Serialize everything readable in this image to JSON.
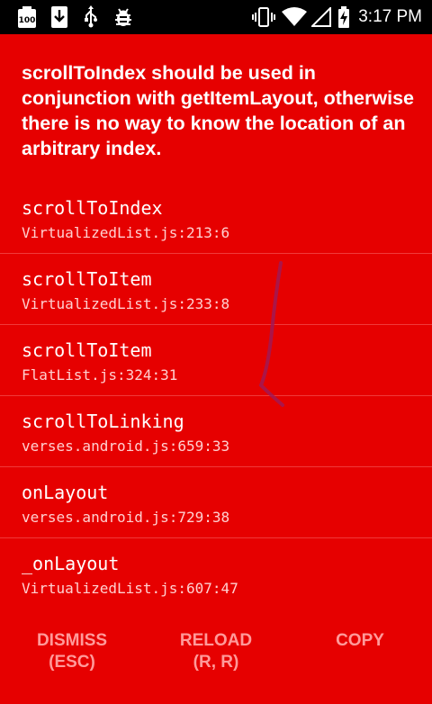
{
  "status_bar": {
    "time": "3:17 PM",
    "left_icons": [
      "battery-100-icon",
      "download-icon",
      "usb-icon",
      "bug-icon"
    ],
    "right_icons": [
      "vibrate-icon",
      "wifi-icon",
      "signal-icon",
      "battery-charging-icon"
    ]
  },
  "error": {
    "message": "scrollToIndex should be used in conjunction with getItemLayout, otherwise there is no way to know the location of an arbitrary index."
  },
  "stack": [
    {
      "method": "scrollToIndex",
      "location": "VirtualizedList.js:213:6"
    },
    {
      "method": "scrollToItem",
      "location": "VirtualizedList.js:233:8"
    },
    {
      "method": "scrollToItem",
      "location": "FlatList.js:324:31"
    },
    {
      "method": "scrollToLinking",
      "location": "verses.android.js:659:33"
    },
    {
      "method": "onLayout",
      "location": "verses.android.js:729:38"
    },
    {
      "method": "_onLayout",
      "location": "VirtualizedList.js:607:47"
    }
  ],
  "buttons": {
    "dismiss": {
      "line1": "DISMISS",
      "line2": "(ESC)"
    },
    "reload": {
      "line1": "RELOAD",
      "line2": "(R, R)"
    },
    "copy": {
      "line1": "COPY"
    }
  },
  "colors": {
    "background": "#e60000",
    "status_bar": "#000000",
    "button_text": "#ff9a9a"
  }
}
